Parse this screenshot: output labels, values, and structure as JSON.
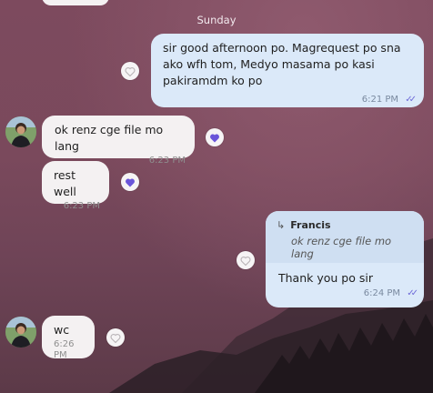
{
  "date_separator": "Sunday",
  "messages": [
    {
      "id": "m1",
      "direction": "out",
      "text": "sir good afternoon po. Magrequest po sna\nako wfh tom, Medyo masama po kasi\npakiramdm ko po",
      "time": "6:21 PM",
      "status_icon": "double-check-icon"
    },
    {
      "id": "m2",
      "direction": "in",
      "text": "ok renz cge file mo lang",
      "time": "6:23 PM",
      "reaction": "heart-icon"
    },
    {
      "id": "m3",
      "direction": "in",
      "text": "rest well",
      "time": "6:23 PM",
      "reaction": "heart-icon"
    },
    {
      "id": "m4",
      "direction": "out",
      "reply_to": {
        "author": "Francis",
        "text": "ok renz cge file mo lang"
      },
      "text": "Thank you po sir",
      "time": "6:24 PM",
      "status_icon": "double-check-icon"
    },
    {
      "id": "m5",
      "direction": "in",
      "text": "wc",
      "time": "6:26 PM",
      "reaction": "heart-outline-icon"
    }
  ],
  "colors": {
    "outgoing_bubble": "#dbe9f9",
    "incoming_bubble": "#f4f1f2",
    "heart_reaction": "#6a55d9",
    "read_checks": "#6f6bd8"
  }
}
